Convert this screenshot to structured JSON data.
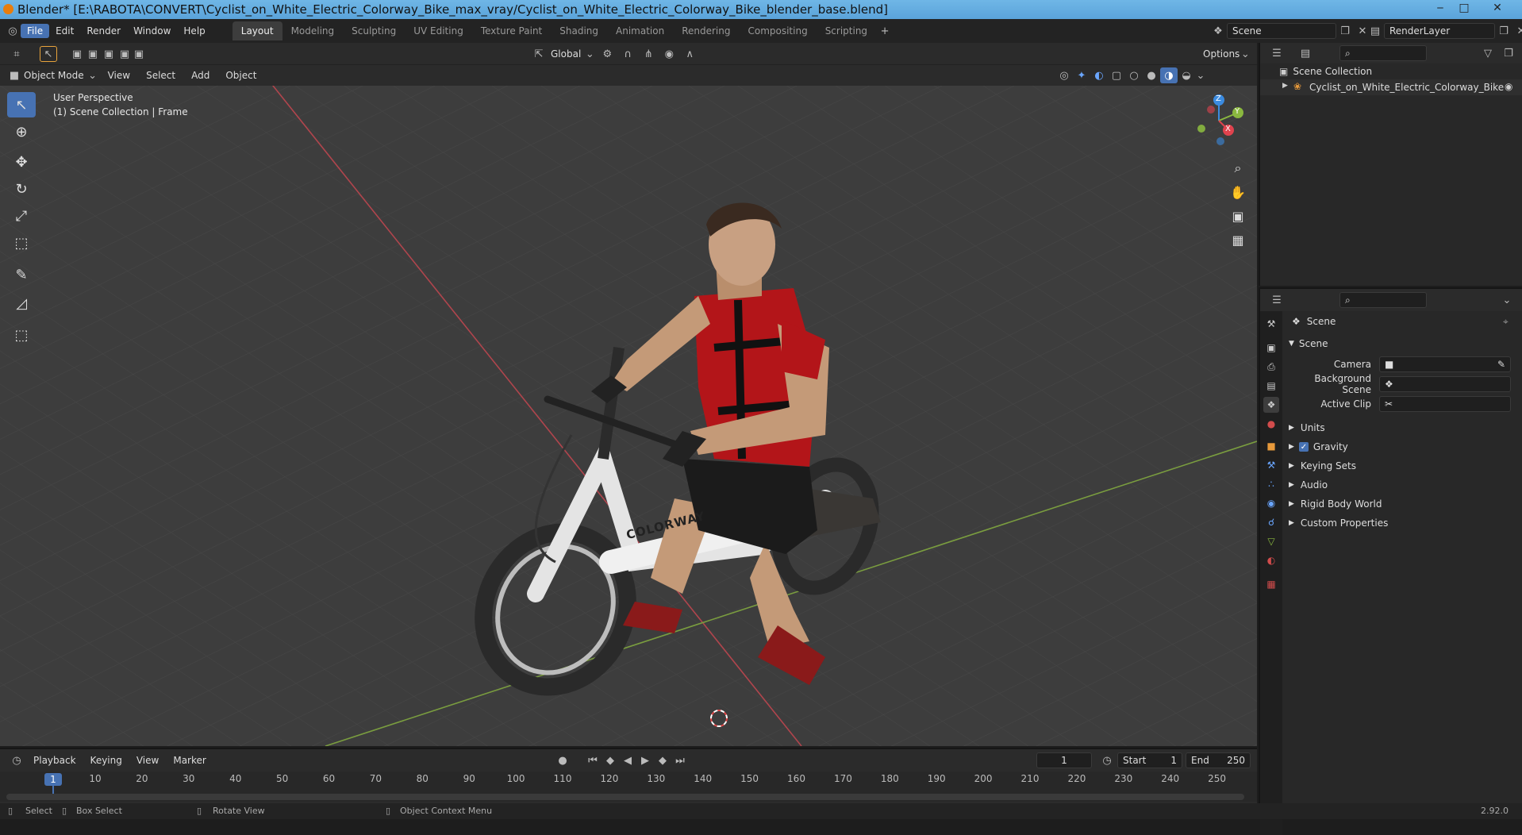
{
  "title": "Blender* [E:\\RABOTA\\CONVERT\\Cyclist_on_White_Electric_Colorway_Bike_max_vray/Cyclist_on_White_Electric_Colorway_Bike_blender_base.blend]",
  "menus": [
    "File",
    "Edit",
    "Render",
    "Window",
    "Help"
  ],
  "workspaces": [
    "Layout",
    "Modeling",
    "Sculpting",
    "UV Editing",
    "Texture Paint",
    "Shading",
    "Animation",
    "Rendering",
    "Compositing",
    "Scripting"
  ],
  "scene_name": "Scene",
  "render_layer": "RenderLayer",
  "header": {
    "transform_orientation": "Global",
    "options": "Options",
    "mode": "Object Mode",
    "menus": [
      "View",
      "Select",
      "Add",
      "Object"
    ]
  },
  "viewport": {
    "perspective": "User Perspective",
    "collection": "(1) Scene Collection | Frame",
    "brand": "COLORWAY",
    "gizmo": {
      "z": "Z",
      "y": "Y",
      "x": "X"
    }
  },
  "outliner": {
    "root": "Scene Collection",
    "item": "Cyclist_on_White_Electric_Colorway_Bike"
  },
  "properties": {
    "context": "Scene",
    "section": "Scene",
    "fields": [
      {
        "label": "Camera",
        "value": ""
      },
      {
        "label": "Background Scene",
        "value": ""
      },
      {
        "label": "Active Clip",
        "value": ""
      }
    ],
    "panels": [
      "Units",
      "Gravity",
      "Keying Sets",
      "Audio",
      "Rigid Body World",
      "Custom Properties"
    ],
    "gravity_checked": true
  },
  "timeline": {
    "menus": [
      "Playback",
      "Keying",
      "View",
      "Marker"
    ],
    "current": "1",
    "start_label": "Start",
    "start": "1",
    "end_label": "End",
    "end": "250",
    "current_marker": "1",
    "ticks": [
      "10",
      "20",
      "30",
      "40",
      "50",
      "60",
      "70",
      "80",
      "90",
      "100",
      "110",
      "120",
      "130",
      "140",
      "150",
      "160",
      "170",
      "180",
      "190",
      "200",
      "210",
      "220",
      "230",
      "240",
      "250"
    ]
  },
  "status": {
    "select": "Select",
    "box_select": "Box Select",
    "rotate": "Rotate View",
    "context_menu": "Object Context Menu",
    "version": "2.92.0"
  },
  "colors": {
    "accent": "#4772b3",
    "axis_x": "#e0434e",
    "axis_y": "#8ab83f",
    "axis_z": "#3b8be0",
    "jersey": "#c2161c"
  }
}
